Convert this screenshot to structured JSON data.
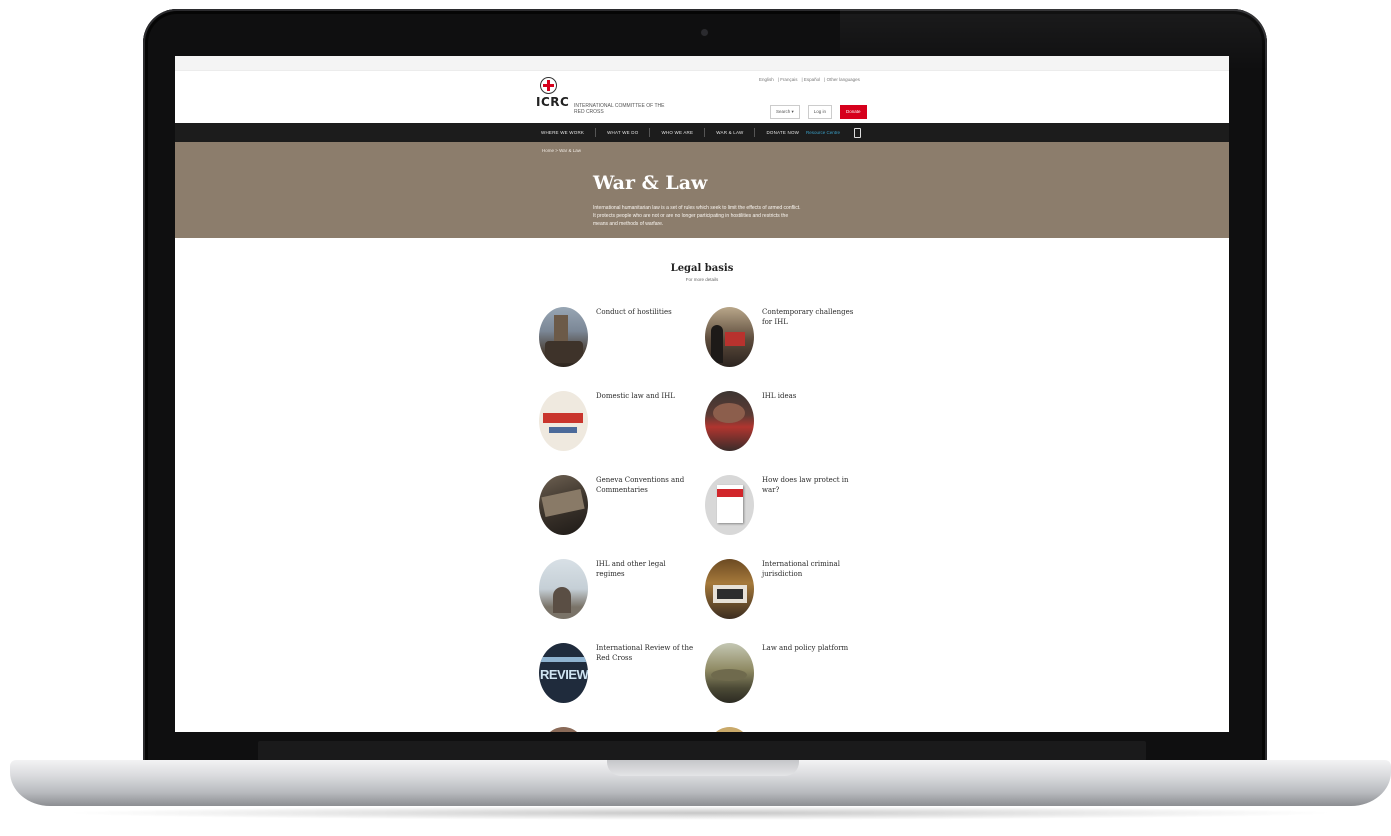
{
  "site": {
    "logo_text": "ICRC",
    "org_name": "INTERNATIONAL COMMITTEE OF THE RED CROSS",
    "languages": [
      "English",
      "Français",
      "Español",
      "Other languages"
    ],
    "header_buttons": {
      "search": "Search ▾",
      "login": "Log in",
      "donate": "Donate"
    },
    "nav": [
      "Where we work",
      "What we do",
      "Who we are",
      "War & Law",
      "Donate now"
    ],
    "nav_right": "Resource Centre",
    "breadcrumb": "Home > War & Law",
    "hero": {
      "title": "War & Law",
      "description": "International humanitarian law is a set of rules which seek to limit the effects of armed conflict. It protects people who are not or are no longer participating in hostilities and restricts the means and methods of warfare."
    },
    "section": {
      "title": "Legal basis",
      "subtitle": "For more details"
    },
    "topics": [
      {
        "label": "Conduct of hostilities",
        "icon": "ruined-building-photo"
      },
      {
        "label": "Contemporary challenges for IHL",
        "icon": "people-photo"
      },
      {
        "label": "Domestic law and IHL",
        "icon": "book-cover-photo"
      },
      {
        "label": "IHL ideas",
        "icon": "red-cross-staff-photo"
      },
      {
        "label": "Geneva Conventions and Commentaries",
        "icon": "rubble-photo"
      },
      {
        "label": "How does law protect in war?",
        "icon": "book-card-photo"
      },
      {
        "label": "IHL and other legal regimes",
        "icon": "person-sky-photo"
      },
      {
        "label": "International criminal jurisdiction",
        "icon": "courtroom-photo"
      },
      {
        "label": "International Review of the Red Cross",
        "icon": "review-cover-photo"
      },
      {
        "label": "Law and policy platform",
        "icon": "hills-landscape-photo"
      },
      {
        "label": "",
        "icon": "partial-photo"
      },
      {
        "label": "",
        "icon": "partial-photo"
      }
    ]
  }
}
